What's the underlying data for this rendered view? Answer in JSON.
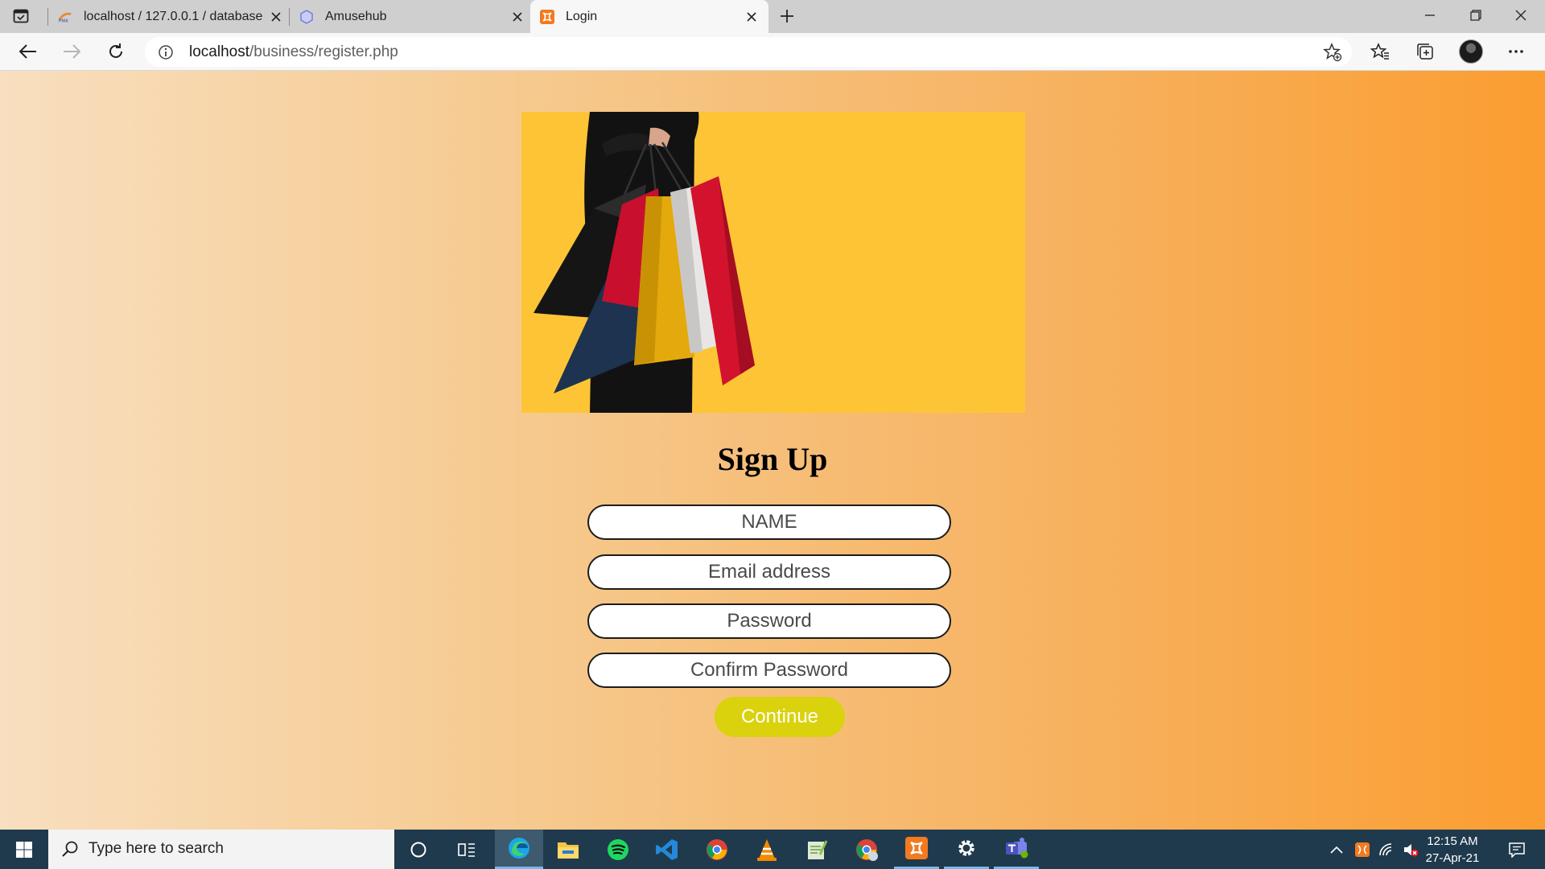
{
  "browser": {
    "tabs": [
      {
        "title": "localhost / 127.0.0.1 / database /",
        "favicon": "phpmyadmin-icon",
        "active": false
      },
      {
        "title": "Amusehub",
        "favicon": "hexagon-icon",
        "active": false
      },
      {
        "title": "Login",
        "favicon": "xampp-icon",
        "active": true
      }
    ],
    "url_host": "localhost",
    "url_path": "/business/register.php"
  },
  "page": {
    "heading": "Sign Up",
    "form": {
      "name_placeholder": "NAME",
      "email_placeholder": "Email address",
      "password_placeholder": "Password",
      "confirm_placeholder": "Confirm Password",
      "submit_label": "Continue"
    },
    "colors": {
      "background_gradient": [
        "#f8dfbf",
        "#fb9d30"
      ],
      "banner": "#fdc535",
      "button": "#d9d20d"
    }
  },
  "taskbar": {
    "search_placeholder": "Type here to search",
    "apps": [
      "cortana-icon",
      "task-view-icon",
      "edge-icon",
      "file-explorer-icon",
      "spotify-icon",
      "vscode-icon",
      "chrome-icon",
      "vlc-icon",
      "notepad-plus-icon",
      "chrome-profile-icon",
      "xampp-icon",
      "settings-icon",
      "teams-icon"
    ],
    "time": "12:15 AM",
    "date": "27-Apr-21"
  }
}
